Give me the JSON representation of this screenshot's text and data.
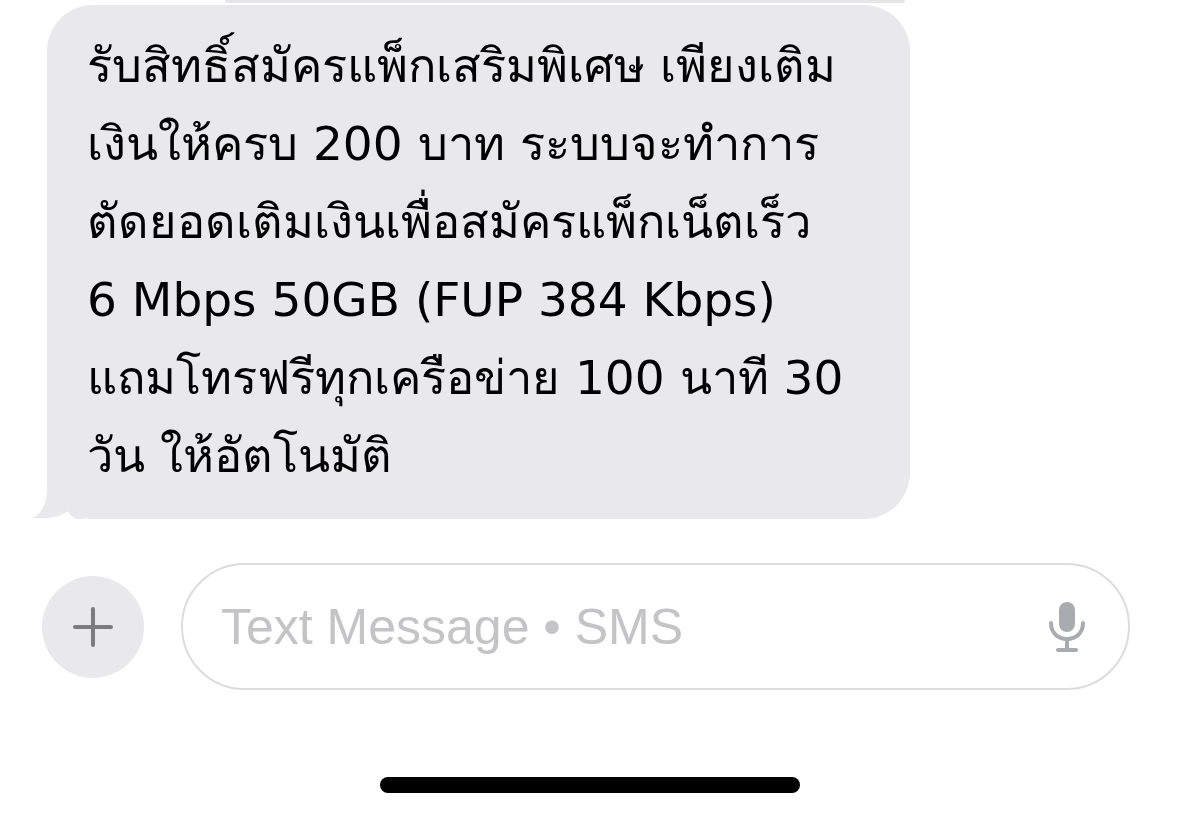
{
  "message": {
    "text": "รับสิทธิ์สมัครแพ็กเสริมพิเศษ เพียงเติมเงินให้ครบ 200 บาท ระบบจะทำการตัดยอดเติมเงินเพื่อสมัครแพ็กเน็ตเร็ว 6 Mbps 50GB (FUP 384 Kbps) แถมโทรฟรีทุกเครือข่าย 100 นาที 30 วัน ให้อัตโนมัติ"
  },
  "composer": {
    "placeholder": "Text Message • SMS"
  }
}
